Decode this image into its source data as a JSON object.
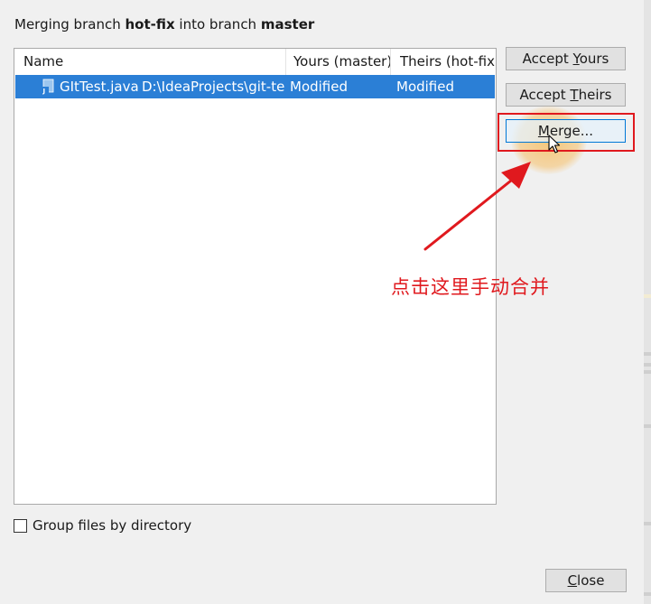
{
  "dialog": {
    "title_prefix": "Merging branch ",
    "source_branch": "hot-fix",
    "title_middle": " into branch ",
    "target_branch": "master"
  },
  "table": {
    "columns": [
      "Name",
      "Yours (master)",
      "Theirs (hot-fix)"
    ],
    "rows": [
      {
        "file": "GItTest.java",
        "path": "D:\\IdeaProjects\\git-te",
        "yours": "Modified",
        "theirs": "Modified",
        "selected": true
      }
    ]
  },
  "buttons": {
    "accept_yours_pre": "Accept ",
    "accept_yours_key": "Y",
    "accept_yours_post": "ours",
    "accept_theirs_pre": "Accept ",
    "accept_theirs_key": "T",
    "accept_theirs_post": "heirs",
    "merge_key": "M",
    "merge_post": "erge...",
    "close_key": "C",
    "close_post": "lose"
  },
  "options": {
    "group_by_directory": "Group files by directory",
    "group_by_directory_checked": false
  },
  "annotation": {
    "text": "点击这里手动合并"
  },
  "colors": {
    "selection": "#2b7fd6",
    "highlight_red": "#e0191e",
    "annotation_red": "#e0191e"
  },
  "icons": {
    "file_icon": "java-file-icon",
    "cursor": "mouse-cursor-icon"
  }
}
